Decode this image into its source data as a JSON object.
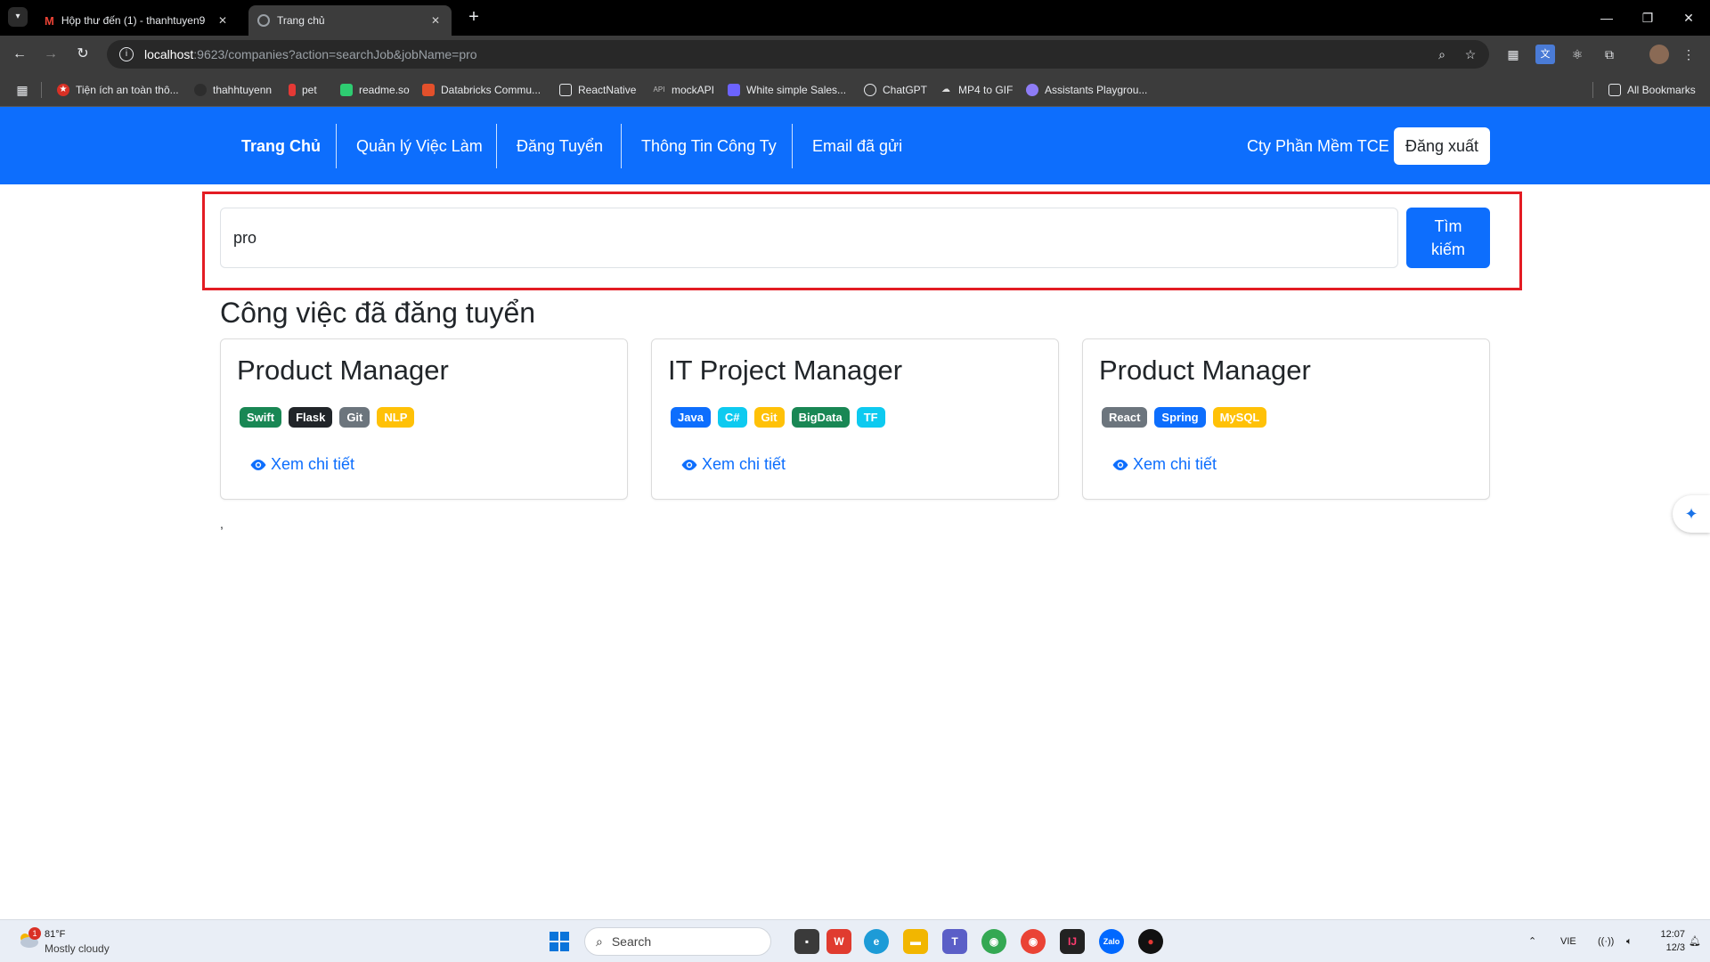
{
  "browser": {
    "tabs": [
      {
        "title": "Hộp thư đến (1) - thanhtuyen9",
        "favicon": "gmail-icon",
        "active": false
      },
      {
        "title": "Trang chủ",
        "favicon": "globe-icon",
        "active": true
      }
    ],
    "url_host": "localhost",
    "url_path": ":9623/companies?action=searchJob&jobName=pro",
    "bookmarks": [
      "Tiện ích an toàn thô...",
      "thahhtuyenn",
      "pet",
      "readme.so",
      "Databricks Commu...",
      "ReactNative",
      "mockAPI",
      "White simple Sales...",
      "ChatGPT",
      "MP4 to GIF",
      "Assistants Playgrou..."
    ],
    "all_bookmarks": "All Bookmarks"
  },
  "nav": {
    "brand": "Trang Chủ",
    "items": [
      "Quản lý Việc Làm",
      "Đăng Tuyển",
      "Thông Tin Công Ty",
      "Email đã gửi"
    ],
    "company": "Cty Phần Mềm TCE",
    "logout": "Đăng xuất"
  },
  "search": {
    "value": "pro",
    "button": "Tìm kiếm"
  },
  "section_title": "Công việc đã đăng tuyển",
  "jobs": [
    {
      "title": "Product Manager",
      "tags": [
        {
          "label": "Swift",
          "color": "#198754"
        },
        {
          "label": "Flask",
          "color": "#212529"
        },
        {
          "label": "Git",
          "color": "#6c757d"
        },
        {
          "label": "NLP",
          "color": "#ffc107"
        }
      ],
      "link": "Xem chi tiết"
    },
    {
      "title": "IT Project Manager",
      "tags": [
        {
          "label": "Java",
          "color": "#0d6efd"
        },
        {
          "label": "C#",
          "color": "#0dcaf0"
        },
        {
          "label": "Git",
          "color": "#ffc107"
        },
        {
          "label": "BigData",
          "color": "#198754"
        },
        {
          "label": "TF",
          "color": "#0dcaf0"
        }
      ],
      "link": "Xem chi tiết"
    },
    {
      "title": "Product Manager",
      "tags": [
        {
          "label": "React",
          "color": "#6c757d"
        },
        {
          "label": "Spring",
          "color": "#0d6efd"
        },
        {
          "label": "MySQL",
          "color": "#ffc107"
        }
      ],
      "link": "Xem chi tiết"
    }
  ],
  "stray_text": ",",
  "taskbar": {
    "weather_badge": "1",
    "weather_temp": "81°F",
    "weather_desc": "Mostly cloudy",
    "search_placeholder": "Search",
    "language": "VIE",
    "time": "12:07",
    "date": "12/3"
  },
  "colors": {
    "primary": "#0d6efd",
    "highlight_border": "#e31c23"
  }
}
